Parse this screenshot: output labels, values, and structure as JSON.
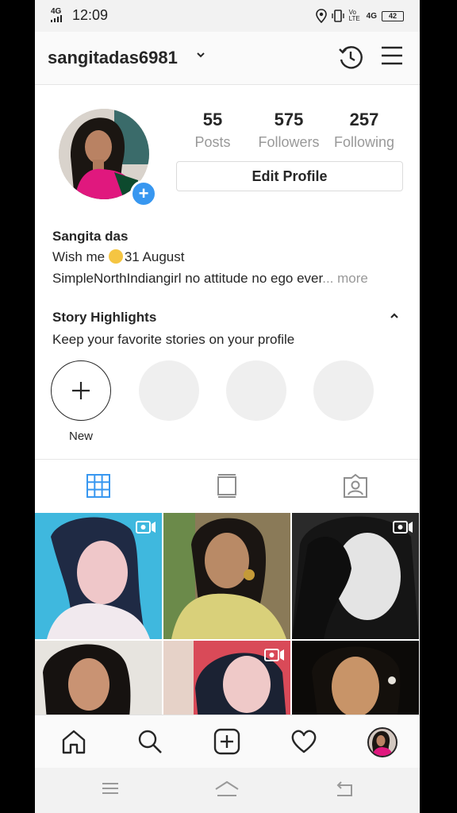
{
  "status_bar": {
    "network": "4G",
    "time": "12:09",
    "volte": "Vo LTE",
    "network2": "4G",
    "battery": "42"
  },
  "header": {
    "username": "sangitadas6981"
  },
  "profile": {
    "stats": [
      {
        "value": "55",
        "label": "Posts"
      },
      {
        "value": "575",
        "label": "Followers"
      },
      {
        "value": "257",
        "label": "Following"
      }
    ],
    "edit_button": "Edit Profile",
    "name": "Sangita das",
    "bio_line1_prefix": "Wish me ",
    "bio_line1_suffix": "31 August",
    "bio_line2": "SimpleNorthIndiangirl no attitude no ego ever",
    "bio_more": "... more"
  },
  "highlights": {
    "title": "Story Highlights",
    "subtitle": "Keep your favorite stories on your profile",
    "new_label": "New"
  },
  "tabs": [
    "grid-icon",
    "feed-icon",
    "tagged-icon"
  ],
  "colors": {
    "accent_blue": "#3897f0",
    "muted_text": "#999999"
  },
  "bottom_nav": [
    "home-icon",
    "search-icon",
    "add-post-icon",
    "activity-heart-icon",
    "profile-avatar"
  ],
  "posts": [
    {
      "type": "video"
    },
    {
      "type": "photo"
    },
    {
      "type": "video"
    },
    {
      "type": "photo"
    },
    {
      "type": "video"
    },
    {
      "type": "photo"
    }
  ]
}
